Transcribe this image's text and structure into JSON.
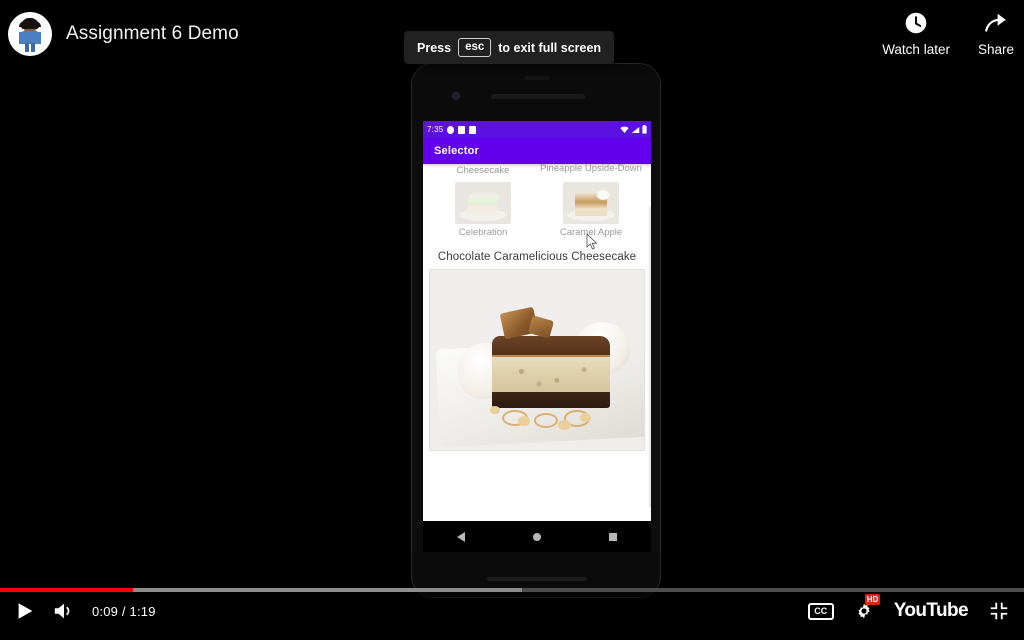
{
  "video": {
    "title": "Assignment 6 Demo",
    "avatar_icon": "person-avatar"
  },
  "fullscreen_tip": {
    "press_label": "Press",
    "key_label": "esc",
    "suffix_label": "to exit full screen"
  },
  "top_actions": [
    {
      "label": "Watch later",
      "icon": "clock-icon"
    },
    {
      "label": "Share",
      "icon": "share-arrow-icon"
    }
  ],
  "player": {
    "play_icon": "play-icon",
    "volume_icon": "volume-icon",
    "current_time": "0:09",
    "separator": "/",
    "duration": "1:19",
    "time_display": "0:09 / 1:19",
    "progress_percent": 13,
    "buffer_percent": 51,
    "progress_color": "#ff0000",
    "captions_label": "CC",
    "settings_icon": "gear-icon",
    "quality_badge": "HD",
    "brand": "YouTube",
    "exit_fullscreen_icon": "exit-fullscreen-icon"
  },
  "phone": {
    "status_bar": {
      "time": "7:35",
      "left_icons": [
        "gear-icon",
        "sd-card-icon",
        "battery-alert-icon"
      ],
      "right_icons": [
        "wifi-icon",
        "cell-signal-icon",
        "battery-icon"
      ]
    },
    "app_bar": {
      "title": "Selector",
      "color": "#6200ee"
    },
    "grid_items": [
      {
        "label": "Chocolate Caramelicious Cheesecake",
        "thumb": "cheesecake-thumb"
      },
      {
        "label": "Pineapple Upside-Down",
        "thumb": "pineapple-thumb"
      },
      {
        "label": "Celebration",
        "thumb": "celebration-cake-thumb"
      },
      {
        "label": "Caramel Apple",
        "thumb": "caramel-apple-thumb"
      }
    ],
    "selected_title": "Chocolate Caramelicious Cheesecake",
    "hero_image": "chocolate-caramelicious-cheesecake-photo",
    "nav_bar": [
      "back-icon",
      "home-icon",
      "recents-icon"
    ]
  }
}
